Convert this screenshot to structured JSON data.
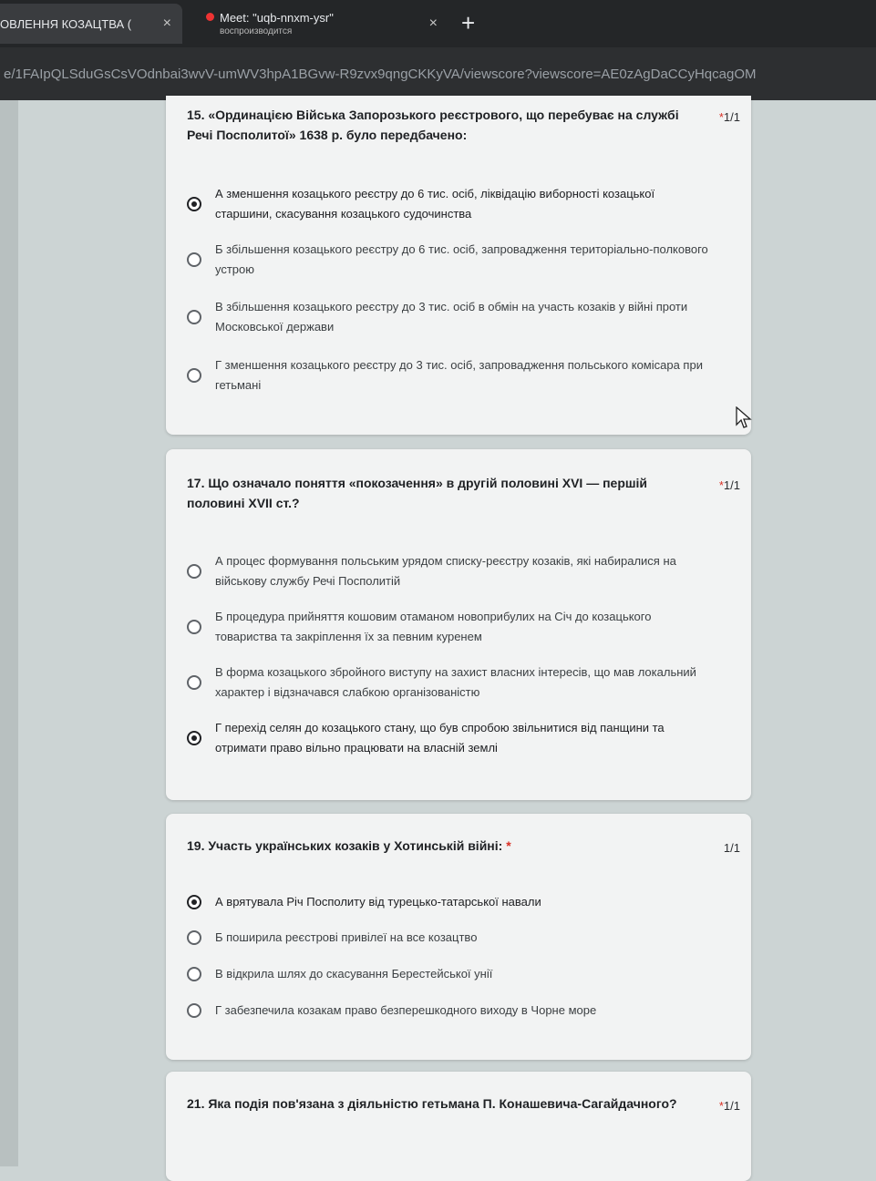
{
  "browser": {
    "tabs": [
      {
        "title": "ОВЛЕННЯ КОЗАЦТВА (",
        "close": "×"
      },
      {
        "title": "Meet: \"uqb-nnxm-ysr\"",
        "subtitle": "воспроизводится",
        "close": "×"
      }
    ],
    "new_tab": "+",
    "url": "e/1FAIpQLSduGsCsVOdnbai3wvV-umWV3hpA1BGvw-R9zvx9qngCKKyVA/viewscore?viewscore=AE0zAgDaCCyHqcagOM"
  },
  "questions": [
    {
      "id": "15",
      "title": "15. «Ординацією Війська Запорозького реєстрового, що перебуває на службі Речі Посполитої» 1638 р. було передбачено:",
      "required": "*",
      "score": "1/1",
      "options": [
        {
          "text": "А зменшення козацького реєстру до 6 тис. осіб, ліквідацію виборності козацької старшини, скасування козацького судочинства",
          "selected": true
        },
        {
          "text": "Б збільшення козацького реєстру до 6 тис. осіб, запровадження територіально-полкового устрою",
          "selected": false
        },
        {
          "text": "В збільшення козацького реєстру до 3 тис. осіб в обмін на участь козаків у війні проти Московської держави",
          "selected": false
        },
        {
          "text": "Г зменшення козацького реєстру до 3 тис. осіб, запровадження польського комісара при гетьмані",
          "selected": false
        }
      ]
    },
    {
      "id": "17",
      "title": "17. Що означало поняття «покозачення» в другій половині XVI — першій половині XVII ст.?",
      "required": "*",
      "score": "1/1",
      "options": [
        {
          "text": "А процес формування польським урядом списку-реєстру козаків, які набиралися на військову службу Речі Посполитій",
          "selected": false
        },
        {
          "text": "Б процедура прийняття кошовим отаманом новоприбулих на Січ до козацького товариства та закріплення їх за певним куренем",
          "selected": false
        },
        {
          "text": "В форма козацького збройного виступу на захист власних інтересів, що мав локальний характер і відзначався слабкою організованістю",
          "selected": false
        },
        {
          "text": "Г перехід селян до козацького стану, що був спробою звільнитися від панщини та отримати право вільно працювати на власній землі",
          "selected": true
        }
      ]
    },
    {
      "id": "19",
      "title": "19. Участь українських козаків у Хотинській війні:",
      "required": "*",
      "score": "1/1",
      "options": [
        {
          "text": "А врятувала Річ Посполиту від турецько-татарської навали",
          "selected": true
        },
        {
          "text": "Б поширила реєстрові привілеї на все козацтво",
          "selected": false
        },
        {
          "text": "В відкрила шлях до скасування Берестейської унії",
          "selected": false
        },
        {
          "text": "Г забезпечила козакам право безперешкодного виходу в Чорне море",
          "selected": false
        }
      ]
    },
    {
      "id": "21",
      "title": "21. Яка подія пов'язана з діяльністю гетьмана П. Конашевича-Сагайдачного?",
      "required": "*",
      "score": "1/1",
      "options": []
    }
  ],
  "colors": {
    "background": "#ccd4d4",
    "card": "#f2f3f3",
    "required": "#d93025",
    "tabbar": "#242628"
  }
}
